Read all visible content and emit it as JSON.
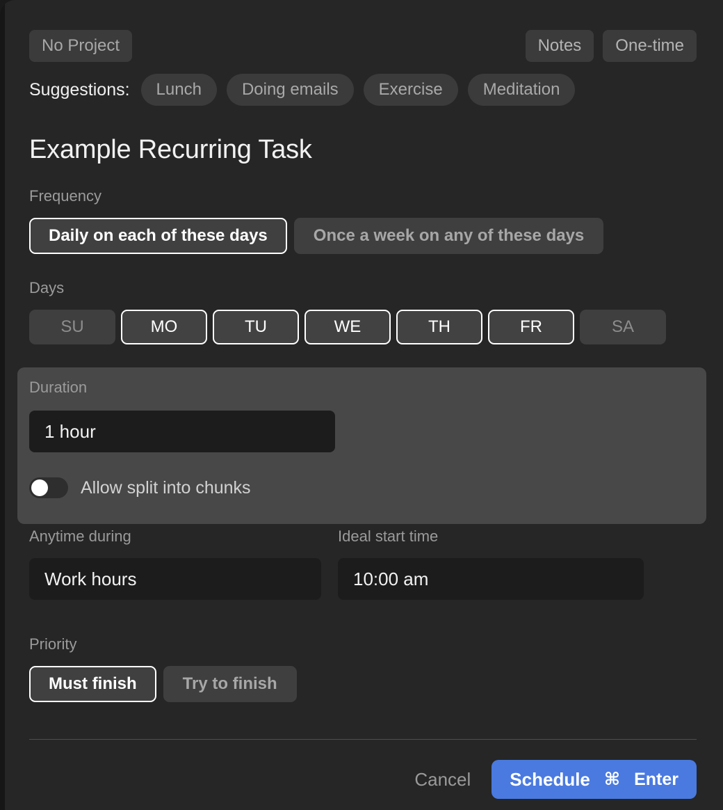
{
  "window": {
    "accent_color": "#4a7ae0",
    "background_color": "#262626",
    "panel_color": "#484848",
    "input_color": "#1c1c1c"
  },
  "topbar": {
    "project_label": "No Project",
    "notes_label": "Notes",
    "one_time_label": "One-time"
  },
  "suggestions": {
    "label": "Suggestions:",
    "chips": [
      {
        "label": "Lunch"
      },
      {
        "label": "Doing emails"
      },
      {
        "label": "Exercise"
      },
      {
        "label": "Meditation"
      }
    ]
  },
  "task": {
    "title": "Example Recurring Task"
  },
  "frequency": {
    "label": "Frequency",
    "options": [
      {
        "label": "Daily on each of these days",
        "selected": true
      },
      {
        "label": "Once a week on any of these days",
        "selected": false
      }
    ]
  },
  "days": {
    "label": "Days",
    "items": [
      {
        "label": "SU",
        "selected": false
      },
      {
        "label": "MO",
        "selected": true
      },
      {
        "label": "TU",
        "selected": true
      },
      {
        "label": "WE",
        "selected": true
      },
      {
        "label": "TH",
        "selected": true
      },
      {
        "label": "FR",
        "selected": true
      },
      {
        "label": "SA",
        "selected": false
      }
    ]
  },
  "duration": {
    "label": "Duration",
    "value": "1 hour",
    "placeholder": "Duration",
    "split_toggle": {
      "label": "Allow split into chunks",
      "on": false
    }
  },
  "anytime_during": {
    "label": "Anytime during",
    "value": "Work hours",
    "placeholder": "Anytime during"
  },
  "ideal_start_time": {
    "label": "Ideal start time",
    "value": "10:00 am",
    "placeholder": "Ideal start time"
  },
  "priority": {
    "label": "Priority",
    "options": [
      {
        "label": "Must finish",
        "selected": true
      },
      {
        "label": "Try to finish",
        "selected": false
      }
    ]
  },
  "footer": {
    "cancel_label": "Cancel",
    "schedule_label": "Schedule",
    "shortcut_modifier": "⌘",
    "shortcut_key": "Enter"
  }
}
